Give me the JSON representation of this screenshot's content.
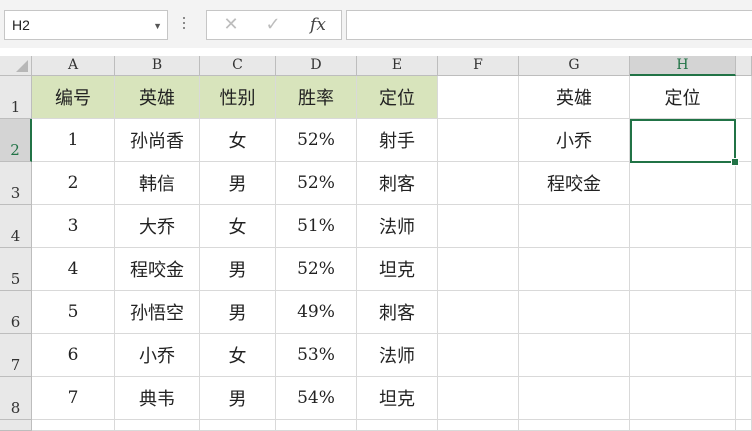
{
  "name_box": {
    "value": "H2"
  },
  "formula_bar": {
    "cancel_glyph": "✕",
    "enter_glyph": "✓",
    "fx_label": "fx",
    "content": ""
  },
  "column_headers": [
    "A",
    "B",
    "C",
    "D",
    "E",
    "F",
    "G",
    "H"
  ],
  "row_headers": [
    "1",
    "2",
    "3",
    "4",
    "5",
    "6",
    "7",
    "8"
  ],
  "selected_cell": "H2",
  "header_fill_color": "#d8e4bc",
  "selection_color": "#217346",
  "table": {
    "headers": [
      "编号",
      "英雄",
      "性别",
      "胜率",
      "定位"
    ],
    "rows": [
      [
        "1",
        "孙尚香",
        "女",
        "52%",
        "射手"
      ],
      [
        "2",
        "韩信",
        "男",
        "52%",
        "刺客"
      ],
      [
        "3",
        "大乔",
        "女",
        "51%",
        "法师"
      ],
      [
        "4",
        "程咬金",
        "男",
        "52%",
        "坦克"
      ],
      [
        "5",
        "孙悟空",
        "男",
        "49%",
        "刺客"
      ],
      [
        "6",
        "小乔",
        "女",
        "53%",
        "法师"
      ],
      [
        "7",
        "典韦",
        "男",
        "54%",
        "坦克"
      ]
    ]
  },
  "lookup": {
    "headers": [
      "英雄",
      "定位"
    ],
    "rows": [
      [
        "小乔",
        ""
      ],
      [
        "程咬金",
        ""
      ]
    ]
  }
}
